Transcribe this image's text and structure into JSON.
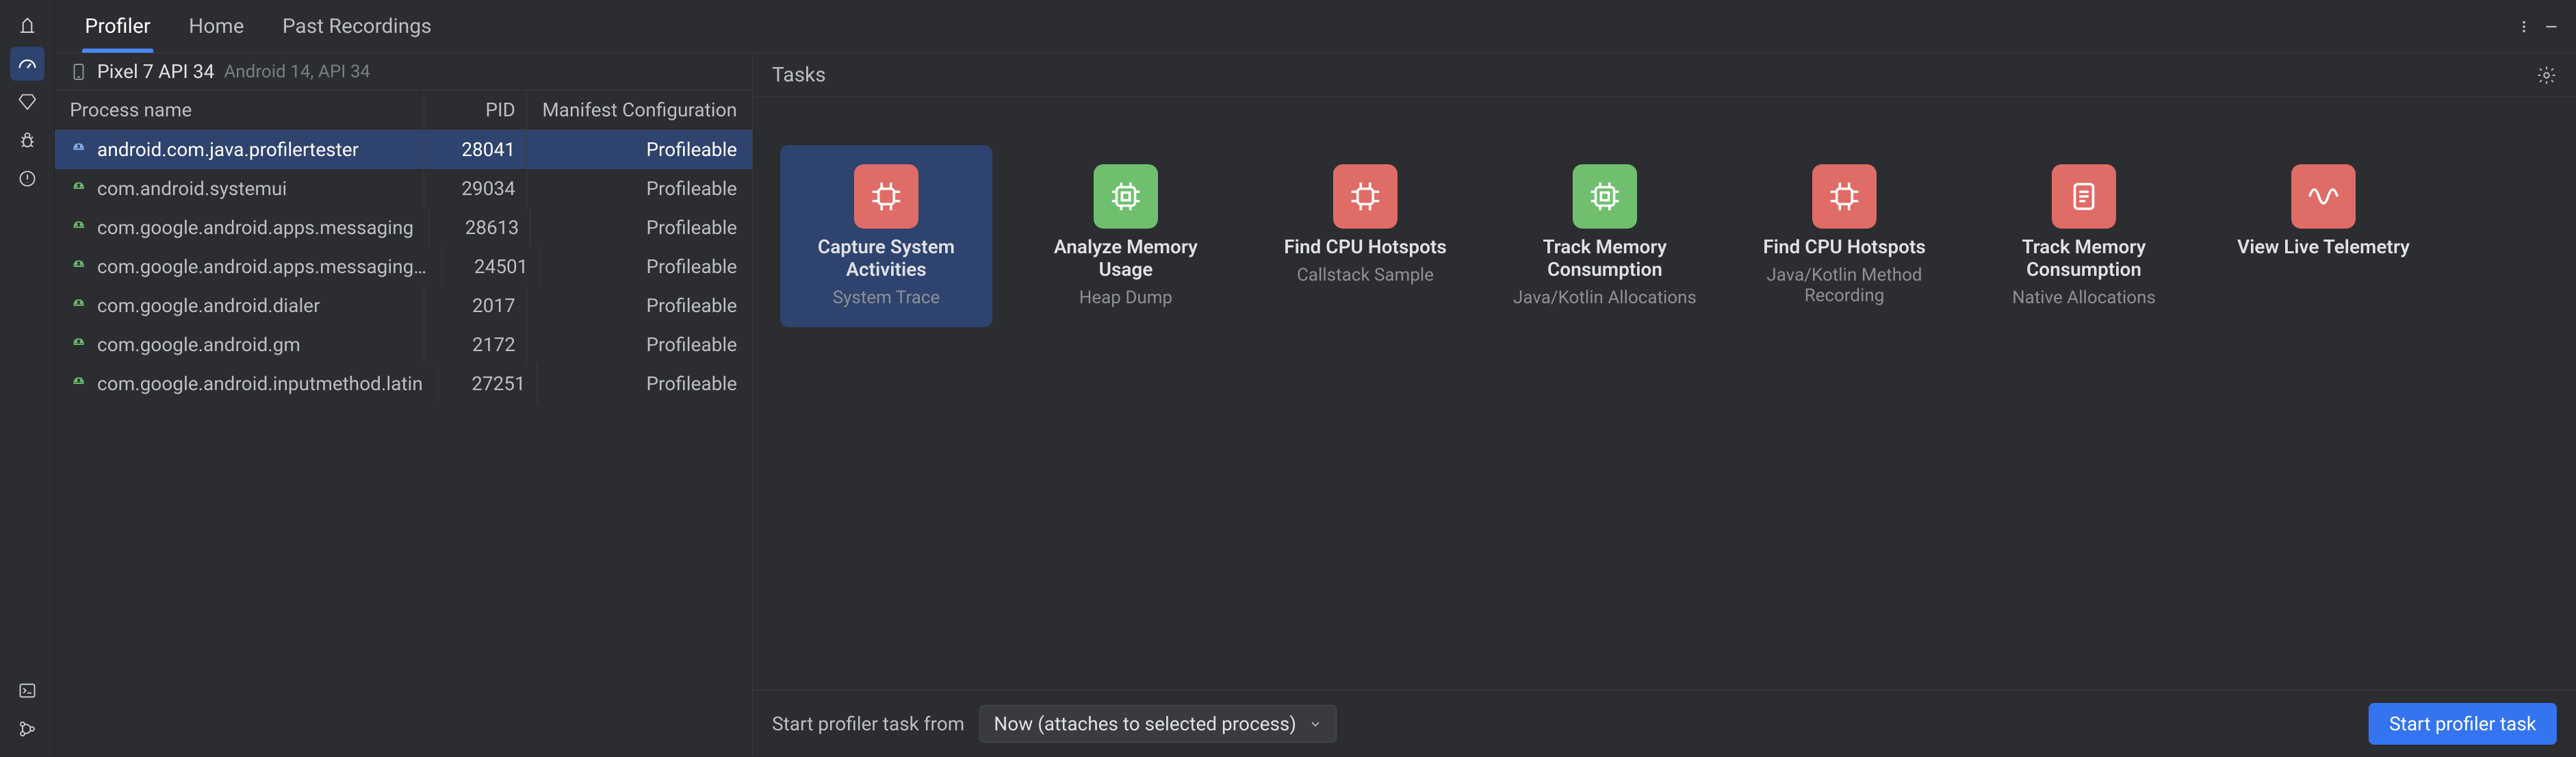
{
  "tabs": {
    "profiler": "Profiler",
    "home": "Home",
    "past": "Past Recordings"
  },
  "device": {
    "name": "Pixel 7 API 34",
    "sub": "Android 14, API 34"
  },
  "columns": {
    "name": "Process name",
    "pid": "PID",
    "mc": "Manifest Configuration"
  },
  "processes": [
    {
      "name": "android.com.java.profilertester",
      "pid": "28041",
      "mc": "Profileable",
      "selected": true
    },
    {
      "name": "com.android.systemui",
      "pid": "29034",
      "mc": "Profileable"
    },
    {
      "name": "com.google.android.apps.messaging",
      "pid": "28613",
      "mc": "Profileable"
    },
    {
      "name": "com.google.android.apps.messaging…",
      "pid": "24501",
      "mc": "Profileable"
    },
    {
      "name": "com.google.android.dialer",
      "pid": "2017",
      "mc": "Profileable"
    },
    {
      "name": "com.google.android.gm",
      "pid": "2172",
      "mc": "Profileable"
    },
    {
      "name": "com.google.android.inputmethod.latin",
      "pid": "27251",
      "mc": "Profileable"
    }
  ],
  "right": {
    "title": "Tasks"
  },
  "tasks": [
    {
      "id": "capture-system",
      "title": "Capture System Activities",
      "sub": "System Trace",
      "color": "#e06c67",
      "selected": true,
      "icon": "cpu"
    },
    {
      "id": "analyze-memory",
      "title": "Analyze Memory Usage",
      "sub": "Heap Dump",
      "color": "#6fbf6f",
      "icon": "chip"
    },
    {
      "id": "cpu-callstack",
      "title": "Find CPU Hotspots",
      "sub": "Callstack Sample",
      "color": "#e06c67",
      "icon": "cpu"
    },
    {
      "id": "mem-jk",
      "title": "Track Memory Consumption",
      "sub": "Java/Kotlin Allocations",
      "color": "#6fbf6f",
      "icon": "chip"
    },
    {
      "id": "cpu-jk",
      "title": "Find CPU Hotspots",
      "sub": "Java/Kotlin Method Recording",
      "color": "#e06c67",
      "icon": "cpu"
    },
    {
      "id": "mem-native",
      "title": "Track Memory Consumption",
      "sub": "Native Allocations",
      "color": "#e06c67",
      "icon": "doc"
    },
    {
      "id": "telemetry",
      "title": "View Live Telemetry",
      "sub": "",
      "color": "#e06c67",
      "icon": "wave"
    }
  ],
  "footer": {
    "label": "Start profiler task from",
    "selectValue": "Now (attaches to selected process)",
    "button": "Start profiler task"
  }
}
